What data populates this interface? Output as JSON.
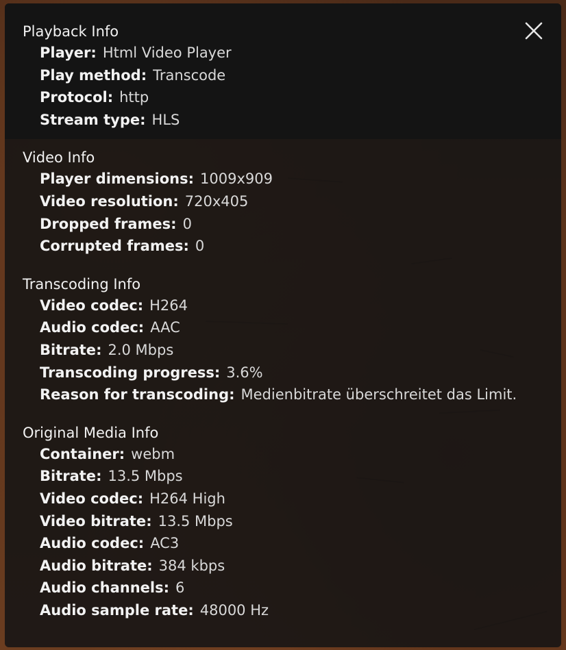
{
  "close_icon": "close-icon",
  "sections": [
    {
      "title": "Playback Info",
      "rows": [
        {
          "label": "Player",
          "value": "Html Video Player"
        },
        {
          "label": "Play method",
          "value": "Transcode"
        },
        {
          "label": "Protocol",
          "value": "http"
        },
        {
          "label": "Stream type",
          "value": "HLS"
        }
      ]
    },
    {
      "title": "Video Info",
      "rows": [
        {
          "label": "Player dimensions",
          "value": "1009x909"
        },
        {
          "label": "Video resolution",
          "value": "720x405"
        },
        {
          "label": "Dropped frames",
          "value": "0"
        },
        {
          "label": "Corrupted frames",
          "value": "0"
        }
      ]
    },
    {
      "title": "Transcoding Info",
      "rows": [
        {
          "label": "Video codec",
          "value": "H264"
        },
        {
          "label": "Audio codec",
          "value": "AAC"
        },
        {
          "label": "Bitrate",
          "value": "2.0 Mbps"
        },
        {
          "label": "Transcoding progress",
          "value": "3.6%"
        },
        {
          "label": "Reason for transcoding",
          "value": "Medienbitrate überschreitet das Limit."
        }
      ]
    },
    {
      "title": "Original Media Info",
      "rows": [
        {
          "label": "Container",
          "value": "webm"
        },
        {
          "label": "Bitrate",
          "value": "13.5 Mbps"
        },
        {
          "label": "Video codec",
          "value": "H264 High"
        },
        {
          "label": "Video bitrate",
          "value": "13.5 Mbps"
        },
        {
          "label": "Audio codec",
          "value": "AC3"
        },
        {
          "label": "Audio bitrate",
          "value": "384 kbps"
        },
        {
          "label": "Audio channels",
          "value": "6"
        },
        {
          "label": "Audio sample rate",
          "value": "48000 Hz"
        }
      ]
    }
  ]
}
